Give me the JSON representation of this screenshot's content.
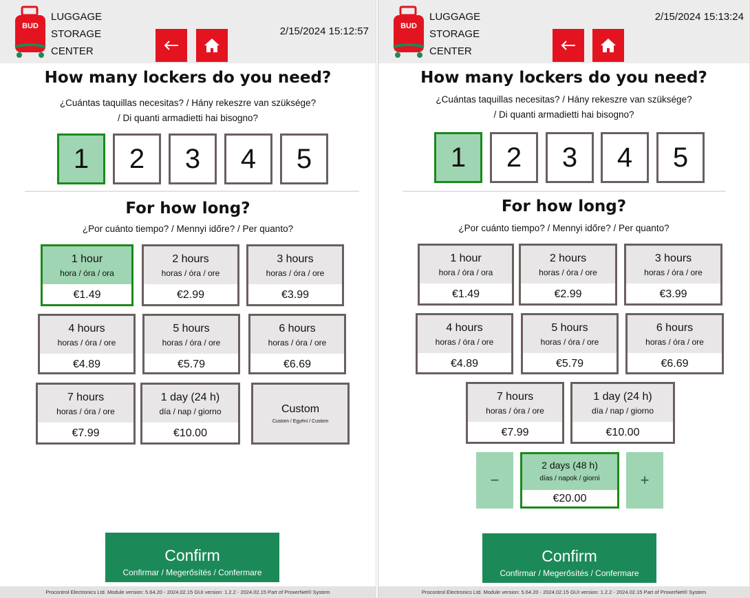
{
  "screens": [
    {
      "brand": {
        "line1": "LUGGAGE",
        "line2": "STORAGE",
        "line3": "CENTER",
        "logo_text": "BUD"
      },
      "datetime": "2/15/2024 15:12:57",
      "q1": {
        "title": "How many lockers do you need?",
        "sub_line1": "¿Cuántas taquillas necesitas? / Hány rekeszre van szüksége?",
        "sub_line2": "/ Di quanti armadietti hai bisogno?"
      },
      "counts": [
        "1",
        "2",
        "3",
        "4",
        "5"
      ],
      "selected_count": "1",
      "q2": {
        "title": "For how long?",
        "subtitle": "¿Por cuánto tiempo? / Mennyi időre? / Per quanto?"
      },
      "durations": [
        {
          "label": "1 hour",
          "sub": "hora / óra / ora",
          "price": "€1.49",
          "selected": true
        },
        {
          "label": "2 hours",
          "sub": "horas / óra / ore",
          "price": "€2.99"
        },
        {
          "label": "3 hours",
          "sub": "horas / óra / ore",
          "price": "€3.99"
        },
        {
          "label": "4 hours",
          "sub": "horas / óra / ore",
          "price": "€4.89"
        },
        {
          "label": "5 hours",
          "sub": "horas / óra / ore",
          "price": "€5.79"
        },
        {
          "label": "6 hours",
          "sub": "horas / óra / ore",
          "price": "€6.69"
        },
        {
          "label": "7 hours",
          "sub": "horas / óra / ore",
          "price": "€7.99"
        },
        {
          "label": "1 day (24 h)",
          "sub": "día / nap / giorno",
          "price": "€10.00"
        }
      ],
      "custom": {
        "label": "Custom",
        "sub": "Custom / Egyéni / Custom"
      },
      "confirm": {
        "label": "Confirm",
        "sub": "Confirmar / Megerősítés / Confermare"
      },
      "footer": "Procontrol Electronics Ltd.  Module version: 5.64.20 - 2024.02.15 GUI version: 1.2.2 - 2024.02.15  Part of ProxerNet® System"
    },
    {
      "brand": {
        "line1": "LUGGAGE",
        "line2": "STORAGE",
        "line3": "CENTER",
        "logo_text": "BUD"
      },
      "datetime": "2/15/2024 15:13:24",
      "q1": {
        "title": "How many lockers do you need?",
        "sub_line1": "¿Cuántas taquillas necesitas? / Hány rekeszre van szüksége?",
        "sub_line2": "/ Di quanti armadietti hai bisogno?"
      },
      "counts": [
        "1",
        "2",
        "3",
        "4",
        "5"
      ],
      "selected_count": "1",
      "q2": {
        "title": "For how long?",
        "subtitle": "¿Por cuánto tiempo? / Mennyi időre? / Per quanto?"
      },
      "durations": [
        {
          "label": "1 hour",
          "sub": "hora / óra / ora",
          "price": "€1.49"
        },
        {
          "label": "2 hours",
          "sub": "horas / óra / ore",
          "price": "€2.99"
        },
        {
          "label": "3 hours",
          "sub": "horas / óra / ore",
          "price": "€3.99"
        },
        {
          "label": "4 hours",
          "sub": "horas / óra / ore",
          "price": "€4.89"
        },
        {
          "label": "5 hours",
          "sub": "horas / óra / ore",
          "price": "€5.79"
        },
        {
          "label": "6 hours",
          "sub": "horas / óra / ore",
          "price": "€6.69"
        },
        {
          "label": "7 hours",
          "sub": "horas / óra / ore",
          "price": "€7.99"
        },
        {
          "label": "1 day (24 h)",
          "sub": "día / nap / giorno",
          "price": "€10.00"
        }
      ],
      "custom_stepper": {
        "minus": "−",
        "plus": "+",
        "label": "2 days (48 h)",
        "sub": "días / napok / giorni",
        "price": "€20.00",
        "selected": true
      },
      "confirm": {
        "label": "Confirm",
        "sub": "Confirmar / Megerősítés / Confermare"
      },
      "footer": "Procontrol Electronics Ltd.  Module version: 5.64.20 - 2024.02.15 GUI version: 1.2.2 - 2024.02.15  Part of ProxerNet® System"
    }
  ],
  "colors": {
    "accent_red": "#e3141f",
    "selected_green": "#1a8a1a",
    "selected_fill": "#9fd5b2",
    "confirm_green": "#1c8a58",
    "card_border": "#6a5f5f",
    "header_bg": "#ececec"
  }
}
